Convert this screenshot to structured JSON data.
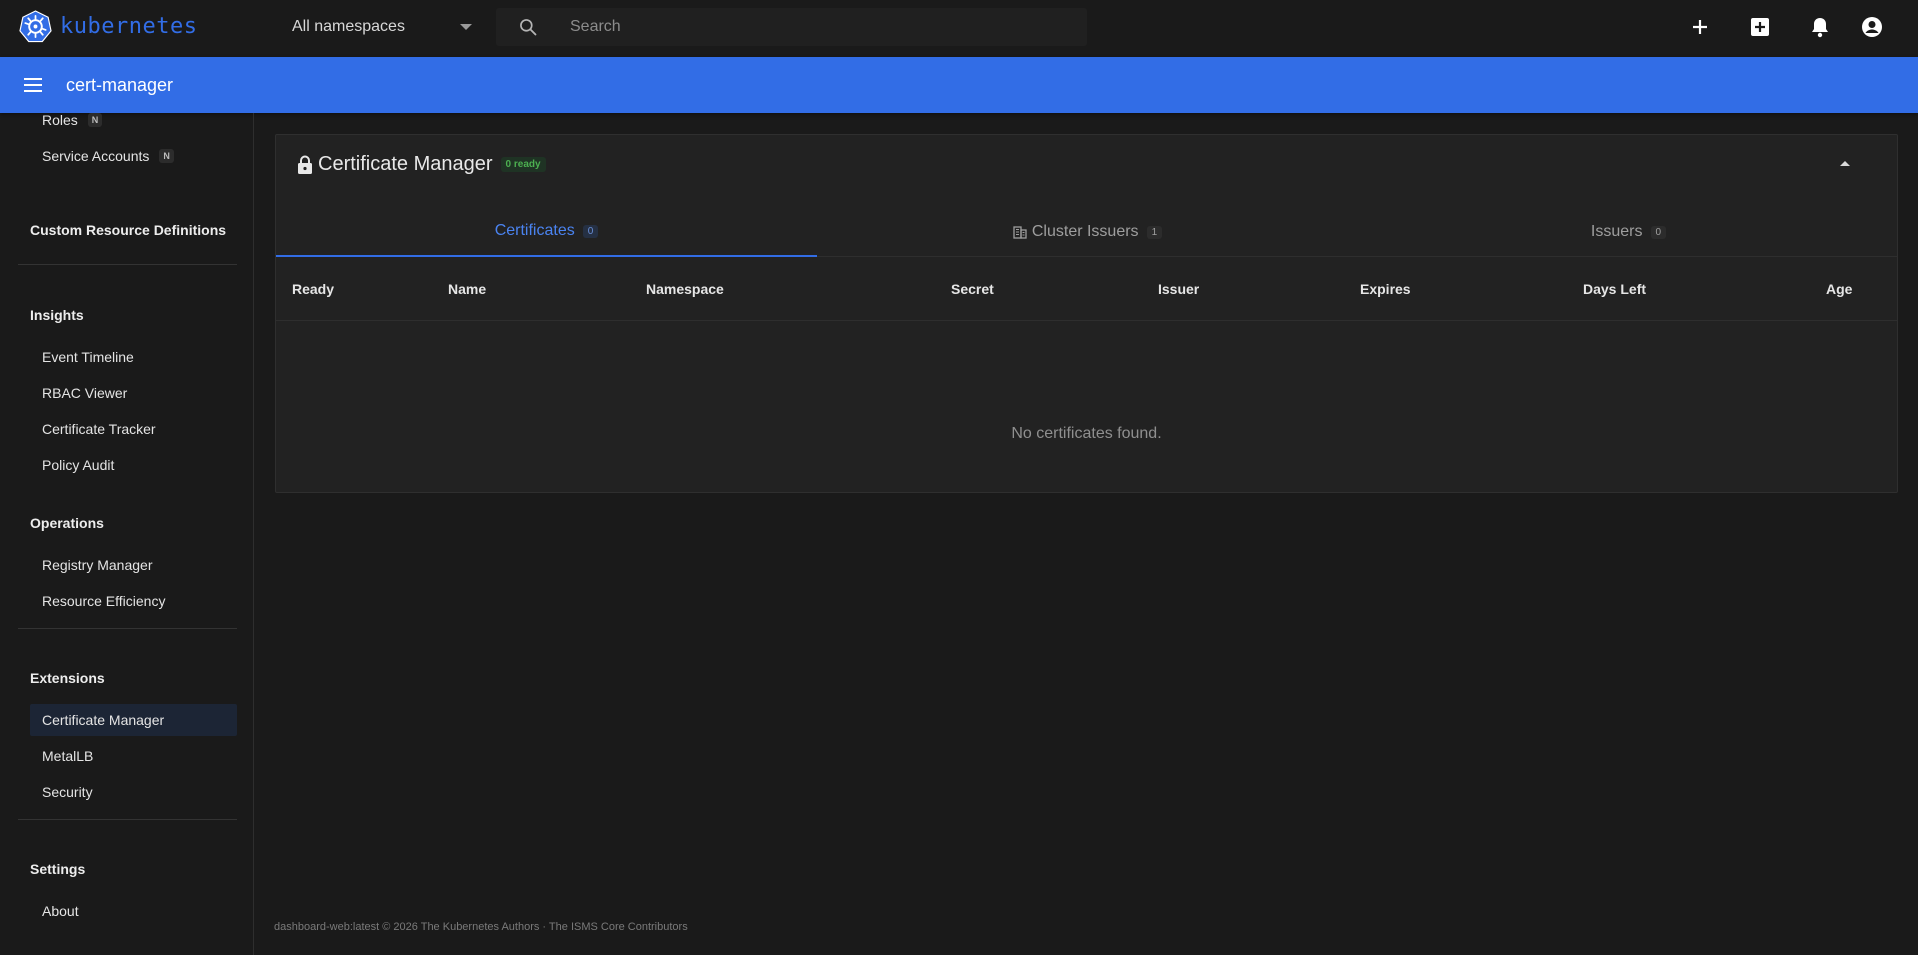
{
  "topbar": {
    "logo_text": "kubernetes",
    "namespace_selected": "All namespaces",
    "search_placeholder": "Search",
    "icons": [
      "plus-icon",
      "add-box-icon",
      "bell-icon",
      "account-circle-icon"
    ]
  },
  "subheader": {
    "title": "cert-manager"
  },
  "sidebar": {
    "access_items": [
      {
        "label": "Roles",
        "badge": "N"
      },
      {
        "label": "Service Accounts",
        "badge": "N"
      }
    ],
    "crd_section": "Custom Resource Definitions",
    "insights": {
      "title": "Insights",
      "items": [
        "Event Timeline",
        "RBAC Viewer",
        "Certificate Tracker",
        "Policy Audit"
      ]
    },
    "operations": {
      "title": "Operations",
      "items": [
        "Registry Manager",
        "Resource Efficiency"
      ]
    },
    "extensions": {
      "title": "Extensions",
      "items": [
        "Certificate Manager",
        "MetalLB",
        "Security"
      ],
      "active": "Certificate Manager"
    },
    "settings": {
      "title": "Settings",
      "items": [
        "About"
      ]
    }
  },
  "card": {
    "title": "Certificate Manager",
    "ready_badge": "0 ready",
    "tabs": [
      {
        "label": "Certificates",
        "count": "0",
        "active": true
      },
      {
        "label": "Cluster Issuers",
        "count": "1",
        "active": false
      },
      {
        "label": "Issuers",
        "count": "0",
        "active": false
      }
    ],
    "columns": [
      "Ready",
      "Name",
      "Namespace",
      "Secret",
      "Issuer",
      "Expires",
      "Days Left",
      "Age"
    ],
    "empty_message": "No certificates found."
  },
  "footer": {
    "text": "dashboard-web:latest © 2026 The Kubernetes Authors · The ISMS Core Contributors"
  },
  "colors": {
    "accent": "#326de6",
    "ready_green": "#4caf50",
    "background": "#1a1a1a"
  }
}
